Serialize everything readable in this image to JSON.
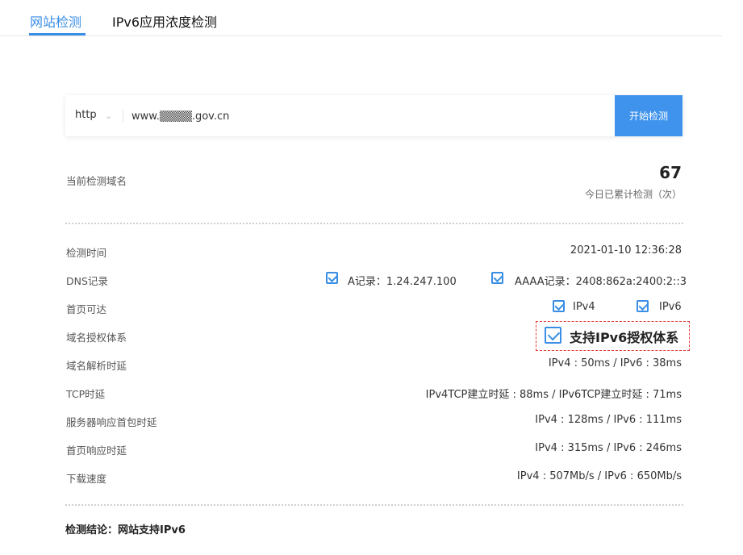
{
  "tabs": {
    "site_check": "网站检测",
    "ipv6_density": "IPv6应用浓度检测"
  },
  "search": {
    "protocol": "http",
    "url_value": "www.▒▒▒▒.gov.cn",
    "start_button": "开始检测"
  },
  "current_domain": {
    "label": "当前检测域名",
    "count": "67",
    "count_caption": "今日已累计检测（次）"
  },
  "rows": {
    "time": {
      "label": "检测时间",
      "value": "2021-01-10 12:36:28"
    },
    "dns": {
      "label": "DNS记录",
      "a_record": "A记录：1.24.247.100",
      "aaaa_record": "AAAA记录：2408:862a:2400:2::3"
    },
    "homepage": {
      "label": "首页可达",
      "ipv4": "IPv4",
      "ipv6": "IPv6"
    },
    "auth": {
      "label": "域名授权体系",
      "value": "支持IPv6授权体系"
    },
    "dns_latency": {
      "label": "域名解析时延",
      "value": "IPv4 : 50ms / IPv6 : 38ms"
    },
    "tcp_latency": {
      "label": "TCP时延",
      "value": "IPv4TCP建立时延 : 88ms / IPv6TCP建立时延 : 71ms"
    },
    "server_first_packet": {
      "label": "服务器响应首包时延",
      "value": "IPv4 : 128ms / IPv6 : 111ms"
    },
    "homepage_latency": {
      "label": "首页响应时延",
      "value": "IPv4 : 315ms / IPv6 : 246ms"
    },
    "download_speed": {
      "label": "下载速度",
      "value": "IPv4 : 507Mb/s  /  IPv6 : 650Mb/s"
    }
  },
  "conclusion": "检测结论：网站支持IPv6",
  "colors": {
    "accent": "#3a8ee6",
    "highlight_border": "#e53935"
  }
}
